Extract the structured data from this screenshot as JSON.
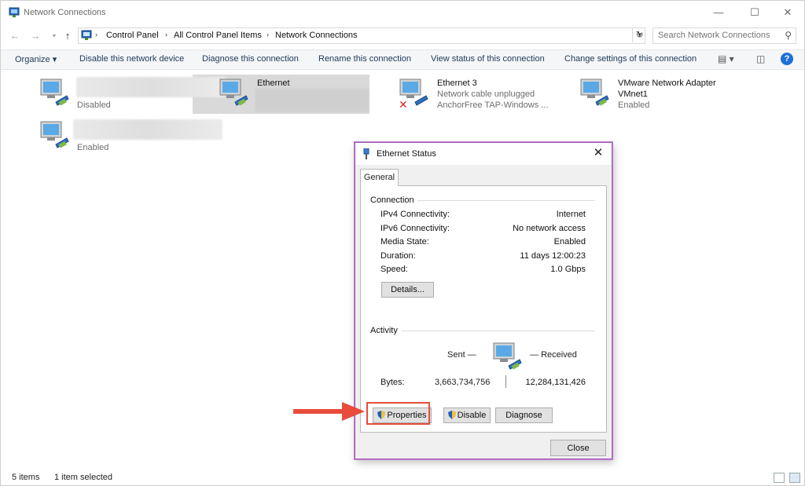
{
  "window": {
    "title": "Network Connections"
  },
  "address": {
    "crumbs": [
      "Control Panel",
      "All Control Panel Items",
      "Network Connections"
    ],
    "search_placeholder": "Search Network Connections"
  },
  "commands": {
    "organize": "Organize",
    "disable": "Disable this network device",
    "diagnose": "Diagnose this connection",
    "rename": "Rename this connection",
    "view_status": "View status of this connection",
    "change_settings": "Change settings of this connection"
  },
  "items": [
    {
      "name": "",
      "status": "Disabled",
      "detail": ""
    },
    {
      "name": "Ethernet",
      "status": "",
      "detail": ""
    },
    {
      "name": "Ethernet 3",
      "status": "Network cable unplugged",
      "detail": "AnchorFree TAP-Windows ..."
    },
    {
      "name": "VMware Network Adapter",
      "name2": "VMnet1",
      "status": "Enabled"
    },
    {
      "name": "",
      "status": "Enabled"
    }
  ],
  "statusbar": {
    "count": "5 items",
    "selected": "1 item selected"
  },
  "dialog": {
    "title": "Ethernet Status",
    "tab": "General",
    "connection_label": "Connection",
    "rows": [
      {
        "label": "IPv4 Connectivity:",
        "value": "Internet"
      },
      {
        "label": "IPv6 Connectivity:",
        "value": "No network access"
      },
      {
        "label": "Media State:",
        "value": "Enabled"
      },
      {
        "label": "Duration:",
        "value": "11 days 12:00:23"
      },
      {
        "label": "Speed:",
        "value": "1.0 Gbps"
      }
    ],
    "details_button": "Details...",
    "activity_label": "Activity",
    "sent_label": "Sent",
    "received_label": "Received",
    "bytes_label": "Bytes:",
    "bytes_sent": "3,663,734,756",
    "bytes_received": "12,284,131,426",
    "properties_button": "Properties",
    "disable_button": "Disable",
    "diagnose_button": "Diagnose",
    "close_button": "Close"
  },
  "colors": {
    "highlight": "#e74c3c",
    "dialog_border": "#9b59b6",
    "help": "#1e6fd9"
  }
}
